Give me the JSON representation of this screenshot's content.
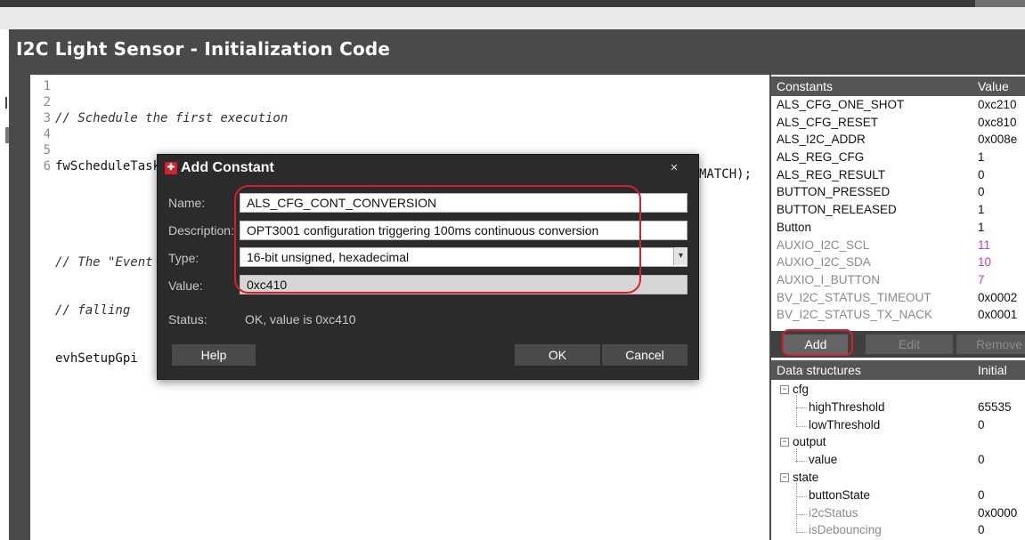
{
  "panel": {
    "title": "I2C Light Sensor - Initialization Code"
  },
  "editor": {
    "line_numbers": [
      "1",
      "2",
      "3",
      "4",
      "5",
      "6"
    ],
    "lines": [
      "// Schedule the first execution",
      "fwScheduleTask(1);",
      "",
      "// The \"Event Handler Code\" state machine shall first wait for a",
      "// falling",
      "evhSetupGpi"
    ],
    "line6_tail": "MATCH);"
  },
  "constants": {
    "header_name": "Constants",
    "header_value": "Value",
    "items": [
      {
        "name": "ALS_CFG_ONE_SHOT",
        "value": "0xc210"
      },
      {
        "name": "ALS_CFG_RESET",
        "value": "0xc810"
      },
      {
        "name": "ALS_I2C_ADDR",
        "value": "0x008e"
      },
      {
        "name": "ALS_REG_CFG",
        "value": "1"
      },
      {
        "name": "ALS_REG_RESULT",
        "value": "0"
      },
      {
        "name": "BUTTON_PRESSED",
        "value": "0"
      },
      {
        "name": "BUTTON_RELEASED",
        "value": "1"
      },
      {
        "name": "Button",
        "value": "1"
      },
      {
        "name": "AUXIO_I2C_SCL",
        "value": "11"
      },
      {
        "name": "AUXIO_I2C_SDA",
        "value": "10"
      },
      {
        "name": "AUXIO_I_BUTTON",
        "value": "7"
      },
      {
        "name": "BV_I2C_STATUS_TIMEOUT",
        "value": "0x0002"
      },
      {
        "name": "BV_I2C_STATUS_TX_NACK",
        "value": "0x0001"
      }
    ],
    "add_label": "Add",
    "edit_label": "Edit",
    "remove_label": "Remove"
  },
  "data_structures": {
    "header_name": "Data structures",
    "header_value": "Initial",
    "cfg": {
      "name": "cfg",
      "highThreshold": {
        "name": "highThreshold",
        "value": "65535"
      },
      "lowThreshold": {
        "name": "lowThreshold",
        "value": "0"
      }
    },
    "output": {
      "name": "output",
      "value": {
        "name": "value",
        "value": "0"
      }
    },
    "state": {
      "name": "state",
      "buttonState": {
        "name": "buttonState",
        "value": "0"
      },
      "i2cStatus": {
        "name": "i2cStatus",
        "value": "0x0000"
      },
      "isDebouncing": {
        "name": "isDebouncing",
        "value": "0"
      }
    }
  },
  "dialog": {
    "title": "Add Constant",
    "close_glyph": "×",
    "name_label": "Name:",
    "name_value": "ALS_CFG_CONT_CONVERSION",
    "description_label": "Description:",
    "description_value": "OPT3001 configuration triggering 100ms continuous conversion",
    "type_label": "Type:",
    "type_value": "16-bit unsigned, hexadecimal",
    "value_label": "Value:",
    "value_value": "0xc410",
    "status_label": "Status:",
    "status_value": "OK, value is 0xc410",
    "help_label": "Help",
    "ok_label": "OK",
    "cancel_label": "Cancel"
  },
  "colors": {
    "frame_bg": "#4a4a4a",
    "dialog_bg": "#2b2b2b",
    "annotation_red": "#d8202a",
    "magenta_value": "#c23ad6"
  },
  "icons": {
    "dialog_logo": "ti-logo-icon",
    "close": "close-icon",
    "dropdown": "chevron-down-icon",
    "tree_expand": "collapse-toggle-icon"
  }
}
